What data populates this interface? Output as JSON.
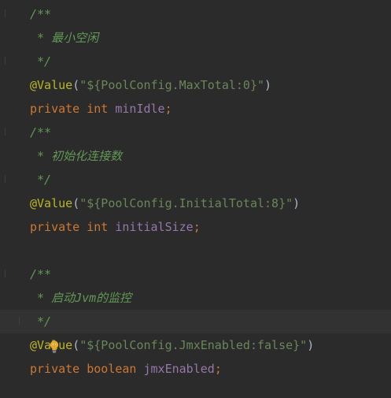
{
  "editor": {
    "language": "Java",
    "colors": {
      "background": "#2b2b2b",
      "current_line": "#323232",
      "comment": "#629755",
      "annotation": "#bbb529",
      "string": "#6a8759",
      "keyword": "#cc7832",
      "field": "#9876aa",
      "default": "#a9b7c6",
      "bulb": "#f0a732"
    },
    "lines": {
      "l1": {
        "comment": "/**"
      },
      "l2": {
        "comment": " * 最小空闲"
      },
      "l3": {
        "comment": " */"
      },
      "l4": {
        "annotation": "@Value",
        "open": "(",
        "string": "\"${PoolConfig.MaxTotal:0}\"",
        "close": ")"
      },
      "l5": {
        "modifier": "private",
        "type": "int",
        "name": "minIdle",
        "end": ";"
      },
      "l6": {
        "comment": "/**"
      },
      "l7": {
        "comment": " * 初始化连接数"
      },
      "l8": {
        "comment": " */"
      },
      "l9": {
        "annotation": "@Value",
        "open": "(",
        "string": "\"${PoolConfig.InitialTotal:8}\"",
        "close": ")"
      },
      "l10": {
        "modifier": "private",
        "type": "int",
        "name": "initialSize",
        "end": ";"
      },
      "l12": {
        "comment": "/**"
      },
      "l13": {
        "comment": " * 启动Jvm的监控"
      },
      "l14": {
        "comment": " */"
      },
      "l15": {
        "annotation": "@Value",
        "open": "(",
        "string": "\"${PoolConfig.JmxEnabled:false}\"",
        "close": ")"
      },
      "l16": {
        "modifier": "private",
        "type": "boolean",
        "name": "jmxEnabled",
        "end": ";"
      }
    },
    "gutter": {
      "intention_icon": "lightbulb-icon",
      "intention_line": 14
    }
  }
}
